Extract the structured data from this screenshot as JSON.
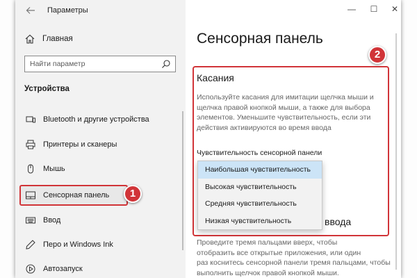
{
  "window": {
    "app_title": "Параметры",
    "controls": {
      "minimize": "—",
      "maximize": "☐",
      "close": "✕"
    }
  },
  "sidebar": {
    "back_icon": "back-arrow-icon",
    "home_label": "Главная",
    "search_placeholder": "Найти параметр",
    "section_title": "Устройства",
    "items": [
      {
        "label": "Bluetooth и другие устройства",
        "icon": "bluetooth-icon",
        "selected": false
      },
      {
        "label": "Принтеры и сканеры",
        "icon": "printer-icon",
        "selected": false
      },
      {
        "label": "Мышь",
        "icon": "mouse-icon",
        "selected": false
      },
      {
        "label": "Сенсорная панель",
        "icon": "touchpad-icon",
        "selected": true
      },
      {
        "label": "Ввод",
        "icon": "keyboard-icon",
        "selected": false
      },
      {
        "label": "Перо и Windows Ink",
        "icon": "pen-icon",
        "selected": false
      },
      {
        "label": "Автозапуск",
        "icon": "autoplay-icon",
        "selected": false
      }
    ]
  },
  "main": {
    "page_title": "Сенсорная панель",
    "section_heading": "Касания",
    "description": "Используйте касания для имитации щелчка мыши и щелчка правой кнопкой мыши, а также для выбора элементов. Уменьшите чувствительность, если эти действия активируются во время ввода",
    "sensitivity_label": "Чувствительность сенсорной панели",
    "dropdown_options": [
      "Наибольшая чувствительность",
      "Высокая чувствительность",
      "Средняя чувствительность",
      "Низкая чувствительность"
    ],
    "selected_option_index": 0,
    "next_heading_visible": "ввода",
    "next_description_lines": [
      "Проведите тремя пальцами вверх, чтобы",
      "отобразить все открытые приложения, или один",
      "раз коснитесь сенсорной панели тремя пальцами, чтобы",
      "выполнить щелчок правой кнопкой мыши."
    ]
  },
  "annotations": {
    "badge_1": "1",
    "badge_2": "2",
    "highlight_color": "#d13438"
  },
  "colors": {
    "selected_option_bg": "#cce4f7",
    "sidebar_bg": "#f2f2f2",
    "accent": "#0078d7"
  }
}
